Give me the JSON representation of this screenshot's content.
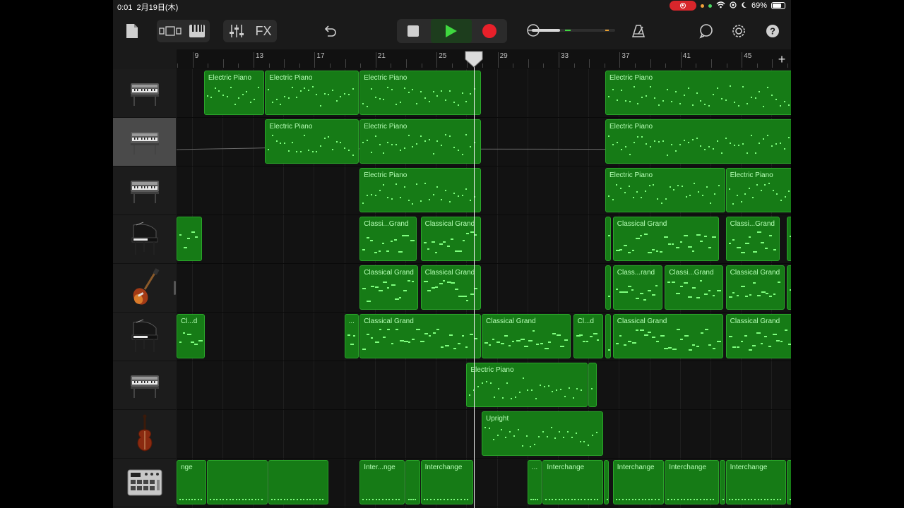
{
  "status_bar": {
    "time": "0:01",
    "date": "2月19日(木)",
    "battery": "69%"
  },
  "toolbar": {
    "fx_label": "FX",
    "meter_level": 0.12
  },
  "ruler": {
    "bars": [
      "9",
      "13",
      "17",
      "21",
      "25",
      "29",
      "33",
      "37",
      "41",
      "45"
    ],
    "add_label": "+"
  },
  "tracks": [
    {
      "icon": "electric-piano-icon",
      "selected": false
    },
    {
      "icon": "electric-piano-icon",
      "selected": true
    },
    {
      "icon": "electric-piano-icon",
      "selected": false
    },
    {
      "icon": "grand-piano-icon",
      "selected": false
    },
    {
      "icon": "bass-guitar-icon",
      "selected": false
    },
    {
      "icon": "grand-piano-icon",
      "selected": false
    },
    {
      "icon": "electric-piano-icon",
      "selected": false
    },
    {
      "icon": "upright-bass-icon",
      "selected": false
    },
    {
      "icon": "drum-machine-icon",
      "selected": false
    }
  ],
  "regions": [
    [
      {
        "name": "Electric Piano",
        "start": 9.8,
        "end": 13.8
      },
      {
        "name": "Electric Piano",
        "start": 13.8,
        "end": 20.0
      },
      {
        "name": "Electric Piano",
        "start": 20.0,
        "end": 28.0
      },
      {
        "name": "Electric Piano",
        "start": 36.1,
        "end": 48.6
      }
    ],
    [
      {
        "name": "Electric Piano",
        "start": 13.8,
        "end": 20.0
      },
      {
        "name": "Electric Piano",
        "start": 20.0,
        "end": 28.0
      },
      {
        "name": "Electric Piano",
        "start": 36.1,
        "end": 48.6
      }
    ],
    [
      {
        "name": "Electric Piano",
        "start": 20.0,
        "end": 28.0
      },
      {
        "name": "Electric Piano",
        "start": 36.1,
        "end": 44.0
      },
      {
        "name": "Electric Piano",
        "start": 44.0,
        "end": 48.6
      }
    ],
    [
      {
        "name": "",
        "start": 8.0,
        "end": 9.7
      },
      {
        "name": "Classi...Grand",
        "start": 20.0,
        "end": 23.8
      },
      {
        "name": "Classical Grand",
        "start": 24.0,
        "end": 28.0
      },
      {
        "name": "",
        "start": 36.1,
        "end": 36.5
      },
      {
        "name": "Classical Grand",
        "start": 36.6,
        "end": 43.6
      },
      {
        "name": "Classi...Grand",
        "start": 44.0,
        "end": 47.6
      },
      {
        "name": "C",
        "start": 48.0,
        "end": 48.6
      }
    ],
    [
      {
        "name": "Classical Grand",
        "start": 20.0,
        "end": 23.9
      },
      {
        "name": "Classical Grand",
        "start": 24.0,
        "end": 28.0
      },
      {
        "name": "",
        "start": 36.1,
        "end": 36.5
      },
      {
        "name": "Class...rand",
        "start": 36.6,
        "end": 39.9
      },
      {
        "name": "Classi...Grand",
        "start": 40.0,
        "end": 43.9
      },
      {
        "name": "Classical Grand",
        "start": 44.0,
        "end": 47.9
      },
      {
        "name": "C",
        "start": 48.0,
        "end": 48.6
      }
    ],
    [
      {
        "name": "Cl...d",
        "start": 8.0,
        "end": 9.9
      },
      {
        "name": "...",
        "start": 19.0,
        "end": 20.0
      },
      {
        "name": "Classical Grand",
        "start": 20.0,
        "end": 28.0
      },
      {
        "name": "Classical Grand",
        "start": 28.0,
        "end": 33.9
      },
      {
        "name": "Cl...d",
        "start": 34.0,
        "end": 36.0
      },
      {
        "name": "",
        "start": 36.1,
        "end": 36.5
      },
      {
        "name": "Classical Grand",
        "start": 36.6,
        "end": 43.9
      },
      {
        "name": "Classical Grand",
        "start": 44.0,
        "end": 48.6
      }
    ],
    [
      {
        "name": "Electric Piano",
        "start": 27.0,
        "end": 35.0
      },
      {
        "name": "",
        "start": 35.0,
        "end": 35.6
      }
    ],
    [
      {
        "name": "Upright",
        "start": 28.0,
        "end": 36.0
      }
    ],
    [
      {
        "name": "nge",
        "start": 8.0,
        "end": 10.0
      },
      {
        "name": "",
        "start": 10.0,
        "end": 14.0
      },
      {
        "name": "",
        "start": 14.0,
        "end": 18.0
      },
      {
        "name": "Inter...nge",
        "start": 20.0,
        "end": 23.0
      },
      {
        "name": "",
        "start": 23.0,
        "end": 24.0
      },
      {
        "name": "Interchange",
        "start": 24.0,
        "end": 27.5
      },
      {
        "name": "...",
        "start": 31.0,
        "end": 32.0
      },
      {
        "name": "Interchange",
        "start": 32.0,
        "end": 36.0
      },
      {
        "name": "",
        "start": 36.0,
        "end": 36.4
      },
      {
        "name": "Interchange",
        "start": 36.6,
        "end": 40.0
      },
      {
        "name": "Interchange",
        "start": 40.0,
        "end": 43.6
      },
      {
        "name": "",
        "start": 43.6,
        "end": 44.0
      },
      {
        "name": "Interchange",
        "start": 44.0,
        "end": 48.0
      },
      {
        "name": "I",
        "start": 48.0,
        "end": 48.6
      }
    ]
  ],
  "playhead_bar": 27.5,
  "colors": {
    "region_fill": "#167b16",
    "region_border": "#2aa52a",
    "note": "#7fff7f",
    "region_text": "#b6ffb6",
    "play": "#3fd83f",
    "record": "#e8202a"
  }
}
